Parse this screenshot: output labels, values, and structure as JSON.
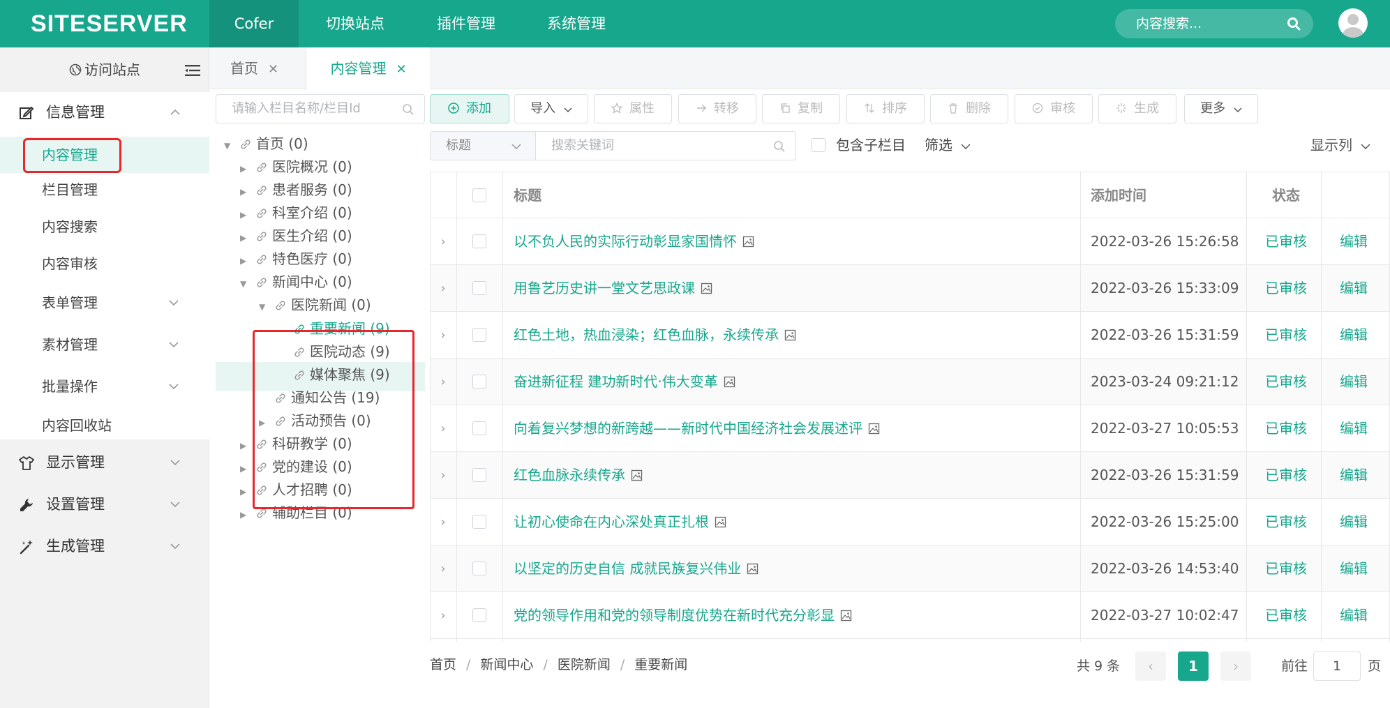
{
  "header": {
    "logo": "SITESERVER",
    "nav": [
      "Cofer",
      "切换站点",
      "插件管理",
      "系统管理"
    ],
    "search_placeholder": "内容搜索..."
  },
  "sidebar": {
    "visit_site": "访问站点",
    "info_group": "信息管理",
    "info_items": [
      "内容管理",
      "栏目管理",
      "内容搜索",
      "内容审核",
      "表单管理",
      "素材管理",
      "批量操作",
      "内容回收站"
    ],
    "display_group": "显示管理",
    "settings_group": "设置管理",
    "generate_group": "生成管理"
  },
  "tabs": [
    {
      "label": "首页"
    },
    {
      "label": "内容管理"
    }
  ],
  "tree": {
    "search_placeholder": "请输入栏目名称/栏目Id",
    "nodes": [
      {
        "label": "首页 (0)"
      },
      {
        "label": "医院概况 (0)"
      },
      {
        "label": "患者服务 (0)"
      },
      {
        "label": "科室介绍 (0)"
      },
      {
        "label": "医生介绍 (0)"
      },
      {
        "label": "特色医疗 (0)"
      },
      {
        "label": "新闻中心 (0)"
      },
      {
        "label": "医院新闻 (0)"
      },
      {
        "label": "重要新闻 (9)"
      },
      {
        "label": "医院动态 (9)"
      },
      {
        "label": "媒体聚焦 (9)"
      },
      {
        "label": "通知公告 (19)"
      },
      {
        "label": "活动预告 (0)"
      },
      {
        "label": "科研教学 (0)"
      },
      {
        "label": "党的建设 (0)"
      },
      {
        "label": "人才招聘 (0)"
      },
      {
        "label": "辅助栏目 (0)"
      }
    ]
  },
  "toolbar": {
    "add": "添加",
    "import": "导入",
    "attr": "属性",
    "move": "转移",
    "copy": "复制",
    "sort": "排序",
    "delete": "删除",
    "audit": "审核",
    "generate": "生成",
    "more": "更多"
  },
  "filter": {
    "field": "标题",
    "keyword_placeholder": "搜索关键词",
    "include_sub": "包含子栏目",
    "filter_label": "筛选",
    "columns_label": "显示列"
  },
  "table": {
    "headers": {
      "title": "标题",
      "time": "添加时间",
      "status": "状态"
    },
    "rows": [
      {
        "title": "以不负人民的实际行动彰显家国情怀",
        "time": "2022-03-26 15:26:58",
        "status": "已审核",
        "edit": "编辑"
      },
      {
        "title": "用鲁艺历史讲一堂文艺思政课",
        "time": "2022-03-26 15:33:09",
        "status": "已审核",
        "edit": "编辑"
      },
      {
        "title": "红色土地，热血浸染；红色血脉，永续传承",
        "time": "2022-03-26 15:31:59",
        "status": "已审核",
        "edit": "编辑"
      },
      {
        "title": "奋进新征程 建功新时代·伟大变革",
        "time": "2023-03-24 09:21:12",
        "status": "已审核",
        "edit": "编辑"
      },
      {
        "title": "向着复兴梦想的新跨越——新时代中国经济社会发展述评",
        "time": "2022-03-27 10:05:53",
        "status": "已审核",
        "edit": "编辑"
      },
      {
        "title": "红色血脉永续传承",
        "time": "2022-03-26 15:31:59",
        "status": "已审核",
        "edit": "编辑"
      },
      {
        "title": "让初心使命在内心深处真正扎根",
        "time": "2022-03-26 15:25:00",
        "status": "已审核",
        "edit": "编辑"
      },
      {
        "title": "以坚定的历史自信 成就民族复兴伟业",
        "time": "2022-03-26 14:53:40",
        "status": "已审核",
        "edit": "编辑"
      },
      {
        "title": "党的领导作用和党的领导制度优势在新时代充分彰显",
        "time": "2022-03-27 10:02:47",
        "status": "已审核",
        "edit": "编辑"
      }
    ]
  },
  "breadcrumb": [
    "首页",
    "新闻中心",
    "医院新闻",
    "重要新闻"
  ],
  "pager": {
    "total": "共 9 条",
    "current": "1",
    "goto": "前往",
    "goto_value": "1",
    "page_unit": "页"
  },
  "colors": {
    "accent": "#17a78d",
    "highlight": "#e8262b"
  }
}
